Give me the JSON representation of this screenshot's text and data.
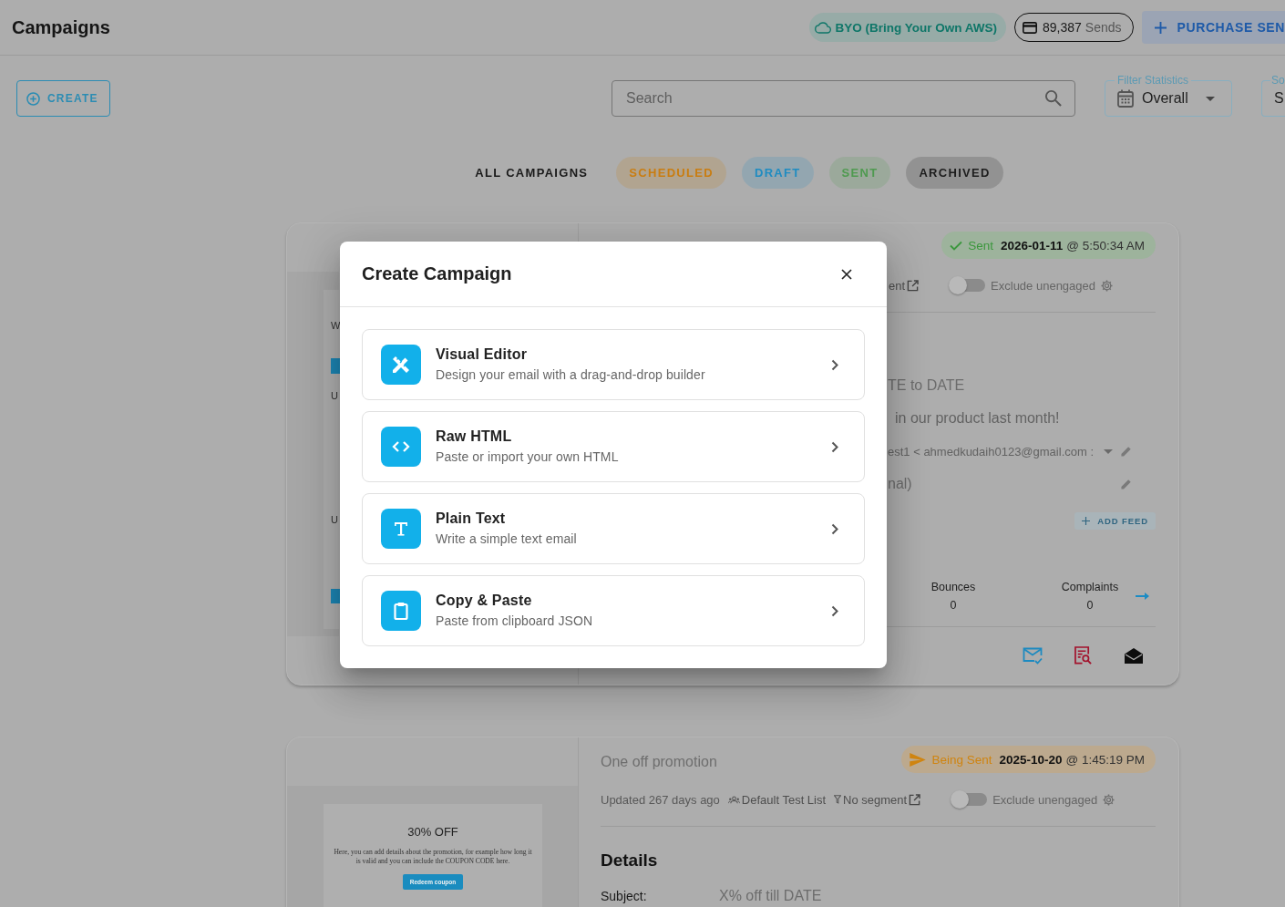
{
  "header": {
    "title": "Campaigns",
    "provider": "BYO (Bring Your Own AWS)",
    "sends": {
      "count": "89,387",
      "label": "Sends"
    },
    "purchase": "PURCHASE SEN"
  },
  "toolbar": {
    "create": "CREATE",
    "search": {
      "placeholder": "Search"
    },
    "filter": {
      "label": "Filter Statistics",
      "value": "Overall"
    },
    "sort": {
      "label": "So",
      "value": "S"
    }
  },
  "tabs": [
    {
      "label": "ALL CAMPAIGNS",
      "selected": true,
      "color": "#1a1a1a"
    },
    {
      "label": "SCHEDULED",
      "selected": false,
      "color": "#c97d12"
    },
    {
      "label": "DRAFT",
      "selected": false,
      "color": "#1f8cc1"
    },
    {
      "label": "SENT",
      "selected": false,
      "color": "#4f9a50"
    },
    {
      "label": "ARCHIVED",
      "selected": false,
      "color": "#1d1d1d"
    }
  ],
  "campaigns": [
    {
      "preview": {
        "kind": "partial",
        "items": [
          {
            "kind": "heading",
            "text": "W"
          },
          {
            "kind": "button"
          },
          {
            "kind": "heading",
            "text": "U"
          },
          {
            "kind": "heading",
            "text": "U"
          },
          {
            "kind": "button"
          }
        ]
      },
      "status": {
        "kind": "sent",
        "label": "Sent",
        "date": "2026-01-11",
        "time": "@ 5:50:34 AM"
      },
      "meta": [
        {
          "kind": "link",
          "text": "ent"
        }
      ],
      "toggle": {
        "label": "Exclude unengaged",
        "on": false,
        "disabled": true
      },
      "fields": [
        {
          "kind": "subject",
          "text": "TE to DATE"
        },
        {
          "kind": "preheader",
          "text": "in our product last month!"
        },
        {
          "kind": "sender",
          "text": "est1 < ahmedkudaih0123@gmail.com :"
        },
        {
          "kind": "reply_to",
          "text": "nal)"
        }
      ],
      "add_feed": {
        "label": "ADD FEED",
        "disabled": true
      },
      "stats": [
        {
          "label": "Bounces",
          "value": "0"
        },
        {
          "label": "Complaints",
          "value": "0"
        }
      ],
      "actions": [
        {
          "kind": "mail_check"
        },
        {
          "kind": "report_search"
        },
        {
          "kind": "open_mail"
        }
      ]
    },
    {
      "preview": {
        "kind": "full",
        "heading": "30% OFF",
        "body": "Here, you can add details about the promotion, for example how long it is valid and you can include the COUPON CODE here.",
        "button": "Redeem coupon"
      },
      "title": "One off promotion",
      "status": {
        "kind": "being_sent",
        "label": "Being Sent",
        "date": "2025-10-20",
        "time": "@ 1:45:19 PM"
      },
      "meta": [
        {
          "kind": "updated",
          "text": "Updated 267 days ago"
        },
        {
          "kind": "list",
          "text": "Default Test List"
        },
        {
          "kind": "segment",
          "text": "No segment"
        }
      ],
      "toggle": {
        "label": "Exclude unengaged",
        "on": false,
        "disabled": true
      },
      "details": {
        "heading": "Details",
        "rows": [
          {
            "label": "Subject:",
            "value": "X% off till DATE"
          }
        ]
      }
    }
  ],
  "dialog": {
    "title": "Create Campaign",
    "options": [
      {
        "kind": "visual",
        "title": "Visual Editor",
        "description": "Design your email with a drag-and-drop builder"
      },
      {
        "kind": "html",
        "title": "Raw HTML",
        "description": "Paste or import your own HTML"
      },
      {
        "kind": "text",
        "title": "Plain Text",
        "description": "Write a simple text email"
      },
      {
        "kind": "paste",
        "title": "Copy & Paste",
        "description": "Paste from clipboard JSON"
      }
    ]
  }
}
